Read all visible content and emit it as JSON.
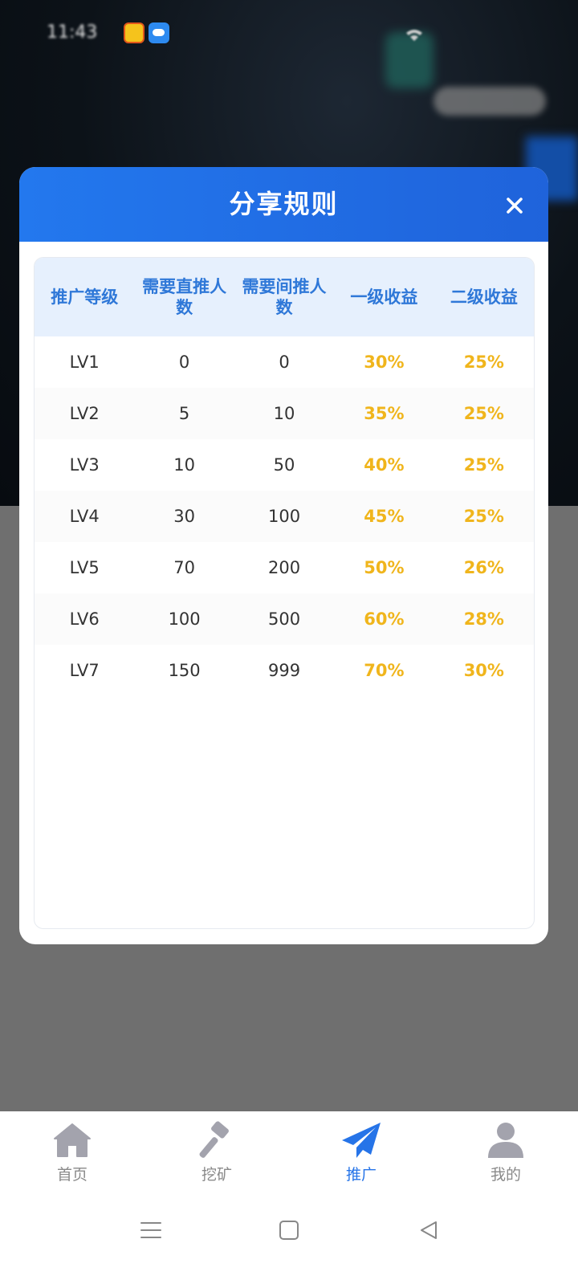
{
  "status_bar": {
    "time": "11:43"
  },
  "modal": {
    "title": "分享规则",
    "close_icon": "close-icon"
  },
  "rules_table": {
    "headers": [
      "推广等级",
      "需要直推人数",
      "需要间推人数",
      "一级收益",
      "二级收益"
    ],
    "rows": [
      [
        "LV1",
        "0",
        "0",
        "30%",
        "25%"
      ],
      [
        "LV2",
        "5",
        "10",
        "35%",
        "25%"
      ],
      [
        "LV3",
        "10",
        "50",
        "40%",
        "25%"
      ],
      [
        "LV4",
        "30",
        "100",
        "45%",
        "25%"
      ],
      [
        "LV5",
        "70",
        "200",
        "50%",
        "26%"
      ],
      [
        "LV6",
        "100",
        "500",
        "60%",
        "28%"
      ],
      [
        "LV7",
        "150",
        "999",
        "70%",
        "30%"
      ]
    ]
  },
  "tabbar": {
    "items": [
      {
        "label": "首页",
        "icon": "home-icon",
        "active": false
      },
      {
        "label": "挖矿",
        "icon": "hammer-icon",
        "active": false
      },
      {
        "label": "推广",
        "icon": "paper-plane-icon",
        "active": true
      },
      {
        "label": "我的",
        "icon": "user-icon",
        "active": false
      }
    ]
  },
  "colors": {
    "header_blue": "#2378ee",
    "header_text_blue": "#2f78d8",
    "gold": "#f0b51c",
    "active_tab": "#2674e8",
    "inactive_tab": "#8a8a8a"
  }
}
